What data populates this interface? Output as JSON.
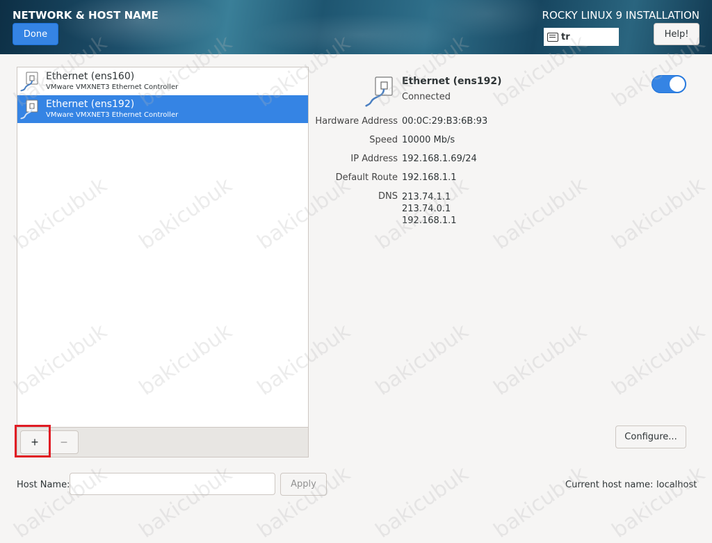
{
  "header": {
    "title": "NETWORK & HOST NAME",
    "done_label": "Done",
    "install_title": "ROCKY LINUX 9 INSTALLATION",
    "keyboard_layout": "tr",
    "help_label": "Help!"
  },
  "devices": [
    {
      "name": "Ethernet (ens160)",
      "controller": "VMware VMXNET3 Ethernet Controller",
      "selected": false
    },
    {
      "name": "Ethernet (ens192)",
      "controller": "VMware VMXNET3 Ethernet Controller",
      "selected": true
    }
  ],
  "toolbar": {
    "add_label": "+",
    "remove_label": "−"
  },
  "details": {
    "name": "Ethernet (ens192)",
    "status": "Connected",
    "enabled": true,
    "hardware_address_label": "Hardware Address",
    "hardware_address": "00:0C:29:B3:6B:93",
    "speed_label": "Speed",
    "speed": "10000 Mb/s",
    "ip_label": "IP Address",
    "ip": "192.168.1.69/24",
    "route_label": "Default Route",
    "route": "192.168.1.1",
    "dns_label": "DNS",
    "dns": [
      "213.74.1.1",
      "213.74.0.1",
      "192.168.1.1"
    ],
    "configure_label": "Configure..."
  },
  "hostname": {
    "label": "Host Name:",
    "value": "",
    "apply_label": "Apply",
    "current_label": "Current host name:",
    "current_value": "localhost"
  },
  "watermark": "bakicubuk",
  "colors": {
    "accent": "#3584e4",
    "highlight": "#e01b24"
  }
}
